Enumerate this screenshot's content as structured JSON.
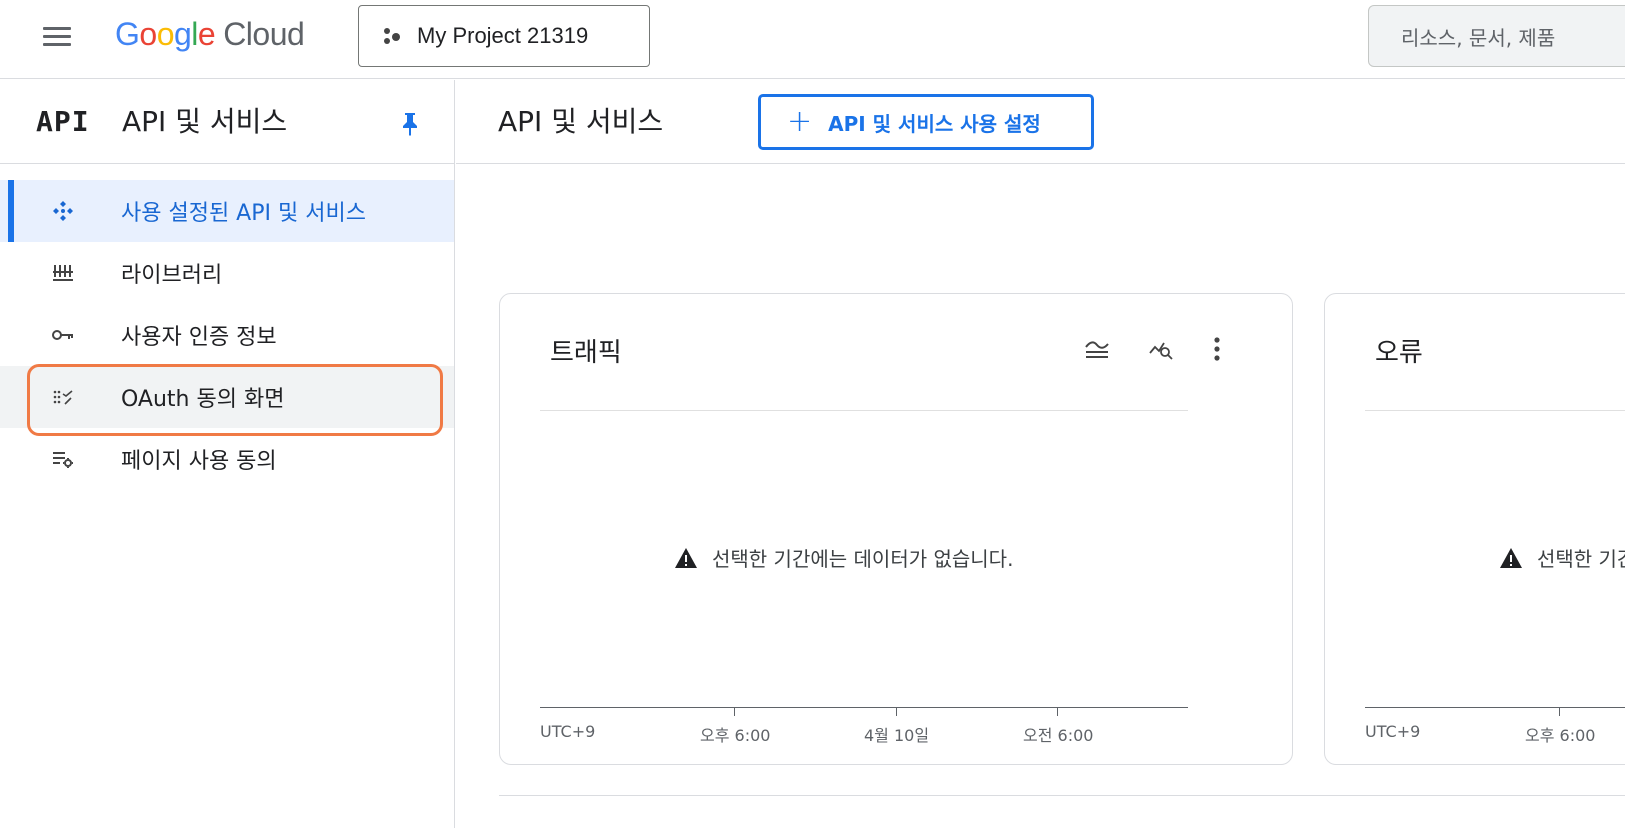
{
  "topbar": {
    "logo_letters": [
      "G",
      "o",
      "o",
      "g",
      "l",
      "e"
    ],
    "logo_suffix": "Cloud",
    "project_name": "My Project 21319",
    "search_placeholder": "리소스, 문서, 제품"
  },
  "sidebar": {
    "logo_text": "API",
    "title": "API 및 서비스",
    "items": [
      {
        "label": "사용 설정된 API 및 서비스",
        "icon": "api-diamond-icon",
        "state": "active"
      },
      {
        "label": "라이브러리",
        "icon": "library-icon",
        "state": "normal"
      },
      {
        "label": "사용자 인증 정보",
        "icon": "key-icon",
        "state": "normal"
      },
      {
        "label": "OAuth 동의 화면",
        "icon": "oauth-consent-icon",
        "state": "hovered-highlighted"
      },
      {
        "label": "페이지 사용 동의",
        "icon": "page-consent-settings-icon",
        "state": "normal"
      }
    ]
  },
  "main": {
    "title": "API 및 서비스",
    "enable_button": "API 및 서비스 사용 설정"
  },
  "cards": [
    {
      "title": "트래픽",
      "no_data": "선택한 기간에는 데이터가 없습니다.",
      "axis_labels": [
        "UTC+9",
        "오후 6:00",
        "4월 10일",
        "오전 6:00"
      ]
    },
    {
      "title": "오류",
      "no_data": "선택한 기간에는 데이터가 없습니다.",
      "axis_labels": [
        "UTC+9",
        "오후 6:00"
      ]
    }
  ],
  "colors": {
    "accent": "#1a73e8",
    "active_bg": "#e8f0fe",
    "highlight": "#f07a45"
  }
}
